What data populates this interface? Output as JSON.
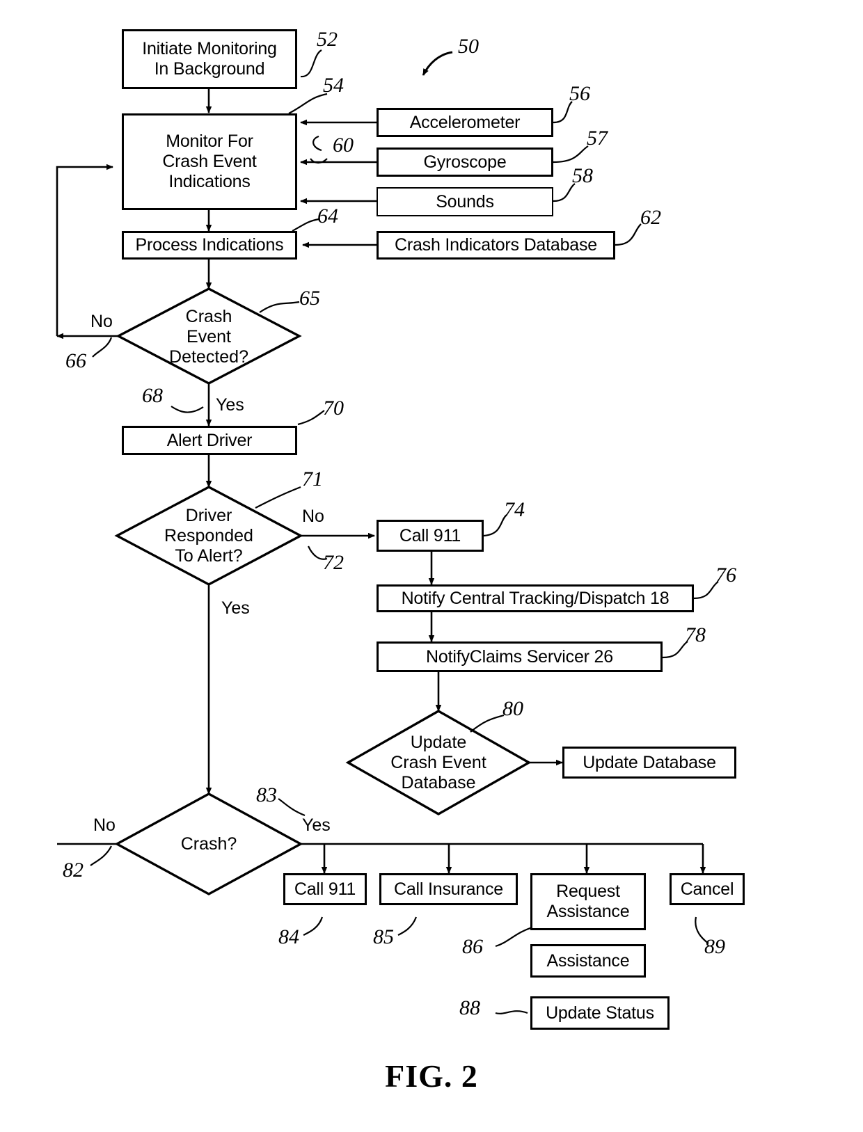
{
  "figure": {
    "caption": "FIG. 2",
    "overall_ref": "50"
  },
  "nodes": {
    "initiate_monitoring": {
      "label": "Initiate Monitoring\nIn Background",
      "ref": "52"
    },
    "monitor_crash": {
      "label": "Monitor For\nCrash Event\nIndications",
      "ref": "54"
    },
    "accelerometer": {
      "label": "Accelerometer",
      "ref": "56"
    },
    "gyroscope": {
      "label": "Gyroscope",
      "ref": "57"
    },
    "sounds": {
      "label": "Sounds",
      "ref": "58"
    },
    "sensor_bus": {
      "ref": "60"
    },
    "process_indications": {
      "label": "Process Indications",
      "ref": "64"
    },
    "crash_indicators_db": {
      "label": "Crash Indicators Database",
      "ref": "62"
    },
    "crash_event_detected": {
      "label": "Crash\nEvent\nDetected?",
      "ref": "65"
    },
    "alert_driver": {
      "label": "Alert Driver",
      "ref": "70"
    },
    "driver_responded": {
      "label": "Driver\nResponded\nTo Alert?",
      "ref": "71"
    },
    "call_911_auto": {
      "label": "Call 911",
      "ref": "74"
    },
    "notify_central": {
      "label": "Notify Central Tracking/Dispatch 18",
      "ref": "76"
    },
    "notify_claims": {
      "label": "NotifyClaims Servicer 26",
      "ref": "78"
    },
    "update_crash_db": {
      "label": "Update\nCrash Event\nDatabase",
      "ref": "80"
    },
    "update_database": {
      "label": "Update Database",
      "ref": ""
    },
    "crash_question": {
      "label": "Crash?",
      "ref": ""
    },
    "call_911_manual": {
      "label": "Call 911",
      "ref": "84"
    },
    "call_insurance": {
      "label": "Call Insurance",
      "ref": "85"
    },
    "request_assistance": {
      "label": "Request\nAssistance",
      "ref": "86"
    },
    "cancel": {
      "label": "Cancel",
      "ref": "89"
    },
    "assistance": {
      "label": "Assistance",
      "ref": ""
    },
    "update_status": {
      "label": "Update Status",
      "ref": "88"
    }
  },
  "edge_labels": {
    "crash_detected_no": "No",
    "crash_detected_no_ref": "66",
    "crash_detected_yes": "Yes",
    "crash_detected_yes_ref": "68",
    "driver_responded_no": "No",
    "driver_responded_no_ref": "72",
    "driver_responded_yes": "Yes",
    "crash_question_no": "No",
    "crash_question_no_ref": "82",
    "crash_question_yes": "Yes",
    "crash_question_yes_ref": "83"
  },
  "colors": {
    "ink": "#000000",
    "paper": "#ffffff"
  }
}
